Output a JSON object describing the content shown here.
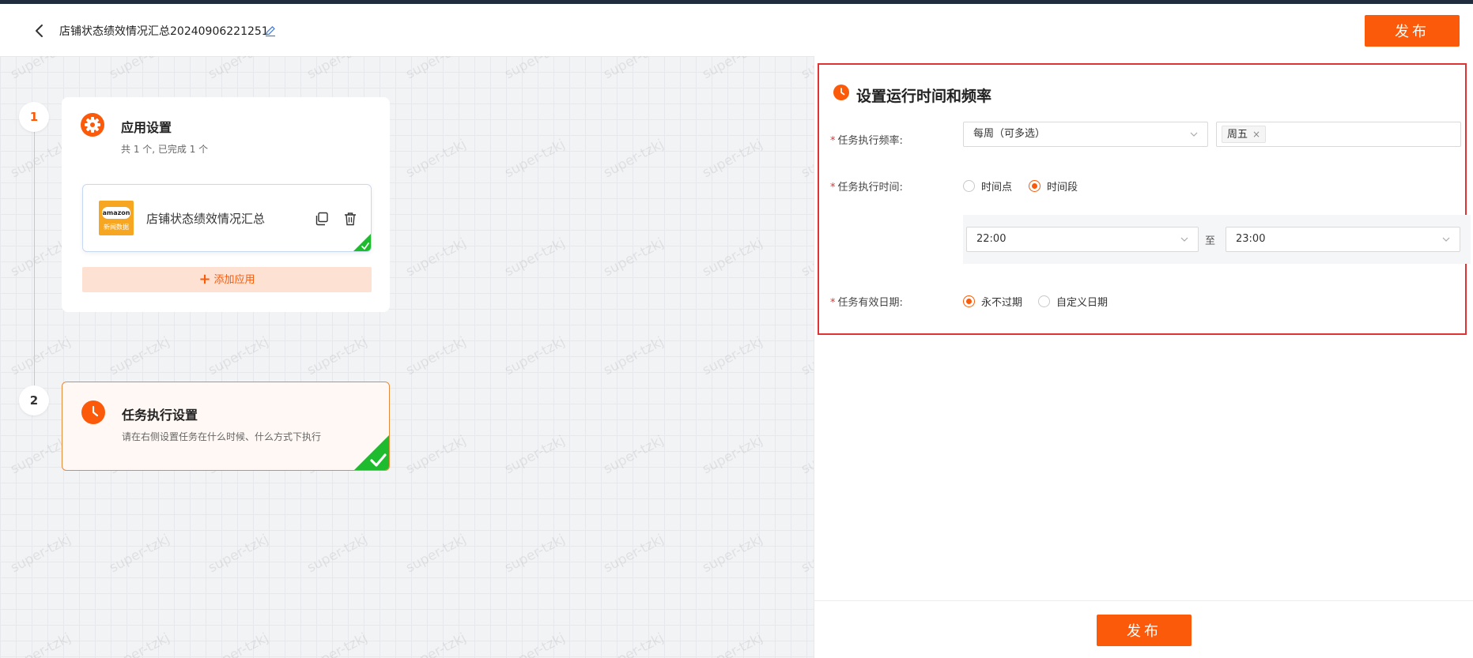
{
  "header": {
    "title": "店铺状态绩效情况汇总20240906221251",
    "publish_label": "发布"
  },
  "canvas": {
    "watermark": "super-tzkj",
    "steps": [
      {
        "number": "1",
        "title": "应用设置",
        "subtitle": "共 1 个, 已完成 1 个",
        "app": {
          "logo_top": "amazon",
          "logo_bottom": "新闻数据",
          "name": "店铺状态绩效情况汇总"
        },
        "add_label": "添加应用"
      },
      {
        "number": "2",
        "title": "任务执行设置",
        "subtitle": "请在右侧设置任务在什么时候、什么方式下执行"
      }
    ]
  },
  "panel": {
    "section_title": "设置运行时间和频率",
    "frequency": {
      "label": "任务执行频率:",
      "value": "每周（可多选）",
      "tags": [
        "周五"
      ]
    },
    "exec_time": {
      "label": "任务执行时间:",
      "options": [
        "时间点",
        "时间段"
      ],
      "selected": "时间段",
      "start": "22:00",
      "to": "至",
      "end": "23:00"
    },
    "valid_date": {
      "label": "任务有效日期:",
      "options": [
        "永不过期",
        "自定义日期"
      ],
      "selected": "永不过期"
    },
    "publish_label": "发布"
  },
  "colors": {
    "accent": "#fa5a0a",
    "highlight_border": "#e03434",
    "success": "#1fbb2f"
  }
}
